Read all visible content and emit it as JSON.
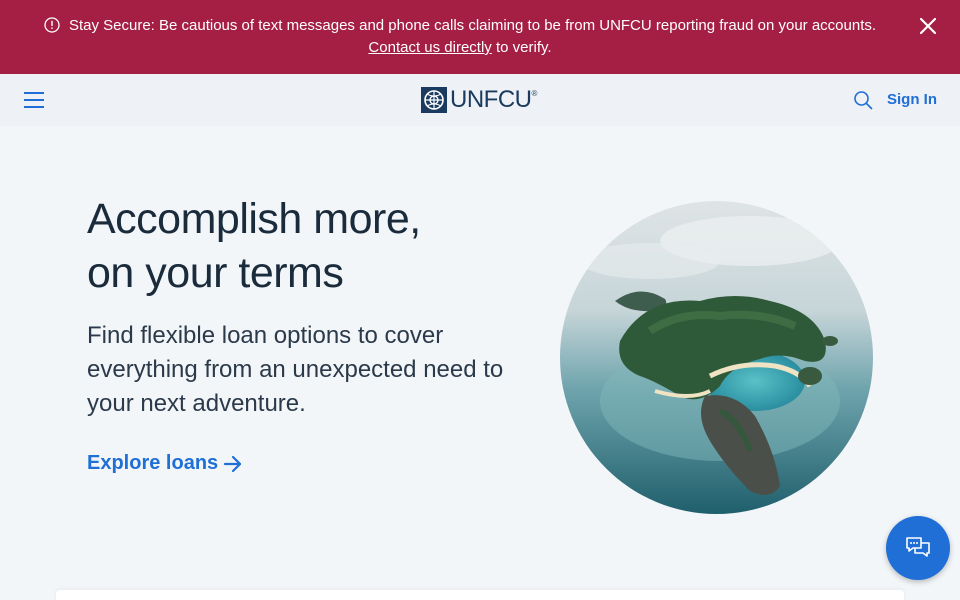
{
  "alert": {
    "message": "Stay Secure: Be cautious of text messages and phone calls claiming to be from UNFCU reporting fraud on your accounts.",
    "link_text": "Contact us directly",
    "after_link": " to verify.",
    "bg_color": "#a51f45"
  },
  "header": {
    "logo_text": "UNFCU",
    "logo_reg": "®",
    "signin_label": "Sign In",
    "accent": "#1f6fd6"
  },
  "hero": {
    "title_line1": "Accomplish more,",
    "title_line2": "on your terms",
    "subtitle": "Find flexible loan options to cover everything from an unexpected need to your next adventure.",
    "cta_label": "Explore loans"
  },
  "icons": [
    "alert-circle-icon",
    "close-icon",
    "hamburger-menu-icon",
    "unfcu-logo-icon",
    "search-icon",
    "arrow-right-icon",
    "chat-icon"
  ]
}
